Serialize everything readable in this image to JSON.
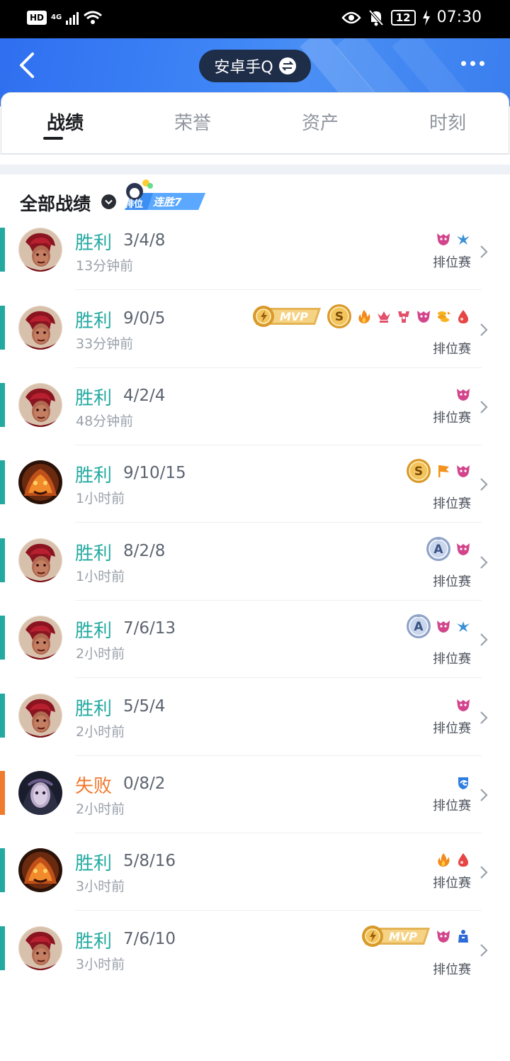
{
  "status_bar": {
    "hd": "HD",
    "network": "4G",
    "battery": "12",
    "time": "07:30"
  },
  "header": {
    "title": "安卓手Q",
    "colors": {
      "gradient_start": "#2f6ff0",
      "gradient_end": "#4a8ff5",
      "pill": "#1e2d48"
    }
  },
  "tabs": [
    {
      "label": "战绩",
      "active": true
    },
    {
      "label": "荣誉",
      "active": false
    },
    {
      "label": "资产",
      "active": false
    },
    {
      "label": "时刻",
      "active": false
    }
  ],
  "section": {
    "title": "全部战绩",
    "badge": {
      "tag": "排位",
      "text": "连胜7"
    }
  },
  "colors": {
    "win": "#23a9a0",
    "loss": "#f07a2e"
  },
  "matches": [
    {
      "result": "胜利",
      "outcome": "win",
      "kda": "3/4/8",
      "time": "13分钟前",
      "mode": "排位赛",
      "hero": "red",
      "badges": [
        "demon-icon",
        "bird-icon"
      ]
    },
    {
      "result": "胜利",
      "outcome": "win",
      "kda": "9/0/5",
      "time": "33分钟前",
      "mode": "排位赛",
      "hero": "red",
      "badges": [
        "mvp-badge",
        "s-grade-coin",
        "fire-icon",
        "crown-icon",
        "tower-icon",
        "demon-icon",
        "gold-stack-icon",
        "blood-drop-icon"
      ]
    },
    {
      "result": "胜利",
      "outcome": "win",
      "kda": "4/2/4",
      "time": "48分钟前",
      "mode": "排位赛",
      "hero": "red",
      "badges": [
        "demon-icon"
      ]
    },
    {
      "result": "胜利",
      "outcome": "win",
      "kda": "9/10/15",
      "time": "1小时前",
      "mode": "排位赛",
      "hero": "fire",
      "badges": [
        "s-grade-coin",
        "flag-icon",
        "demon-icon"
      ]
    },
    {
      "result": "胜利",
      "outcome": "win",
      "kda": "8/2/8",
      "time": "1小时前",
      "mode": "排位赛",
      "hero": "red",
      "badges": [
        "a-grade-coin",
        "demon-icon"
      ]
    },
    {
      "result": "胜利",
      "outcome": "win",
      "kda": "7/6/13",
      "time": "2小时前",
      "mode": "排位赛",
      "hero": "red",
      "badges": [
        "a-grade-coin",
        "demon-icon",
        "bird-icon"
      ]
    },
    {
      "result": "胜利",
      "outcome": "win",
      "kda": "5/5/4",
      "time": "2小时前",
      "mode": "排位赛",
      "hero": "red",
      "badges": [
        "demon-icon"
      ]
    },
    {
      "result": "失败",
      "outcome": "loss",
      "kda": "0/8/2",
      "time": "2小时前",
      "mode": "排位赛",
      "hero": "dark",
      "badges": [
        "shield-swirl-icon"
      ]
    },
    {
      "result": "胜利",
      "outcome": "win",
      "kda": "5/8/16",
      "time": "3小时前",
      "mode": "排位赛",
      "hero": "fire",
      "badges": [
        "fire-icon",
        "blood-drop-icon"
      ]
    },
    {
      "result": "胜利",
      "outcome": "win",
      "kda": "7/6/10",
      "time": "3小时前",
      "mode": "排位赛",
      "hero": "red",
      "badges": [
        "mvp-badge",
        "demon-icon",
        "robe-icon"
      ]
    }
  ]
}
